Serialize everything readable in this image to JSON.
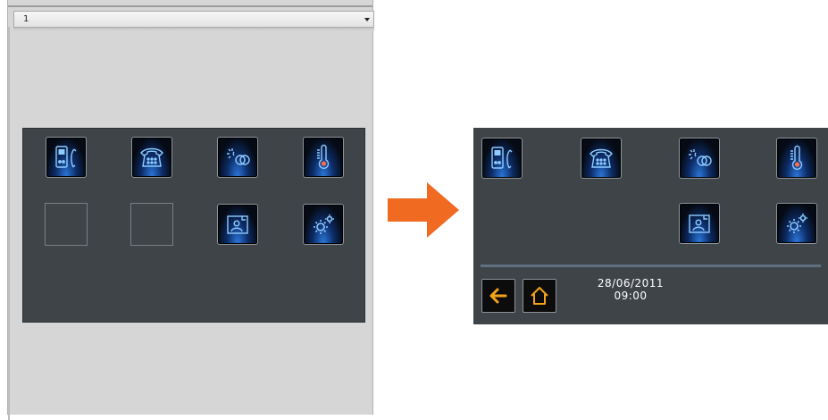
{
  "editor": {
    "dropdown_value": "1"
  },
  "icons": {
    "intercom": "intercom-handset-icon",
    "telephone": "telephone-icon",
    "lighting": "lighting-scenario-icon",
    "thermostat": "thermometer-icon",
    "picture_frame": "picture-frame-icon",
    "settings": "gears-settings-icon",
    "back": "back-arrow-icon",
    "home": "home-icon"
  },
  "preview": {
    "date": "28/06/2011",
    "time": "09:00"
  },
  "colors": {
    "panel_bg": "#3f4449",
    "editor_bg": "#d6d6d6",
    "icon_glow": "#2a74d6",
    "arrow": "#f06a22",
    "nav_accent": "#f5a21b"
  }
}
